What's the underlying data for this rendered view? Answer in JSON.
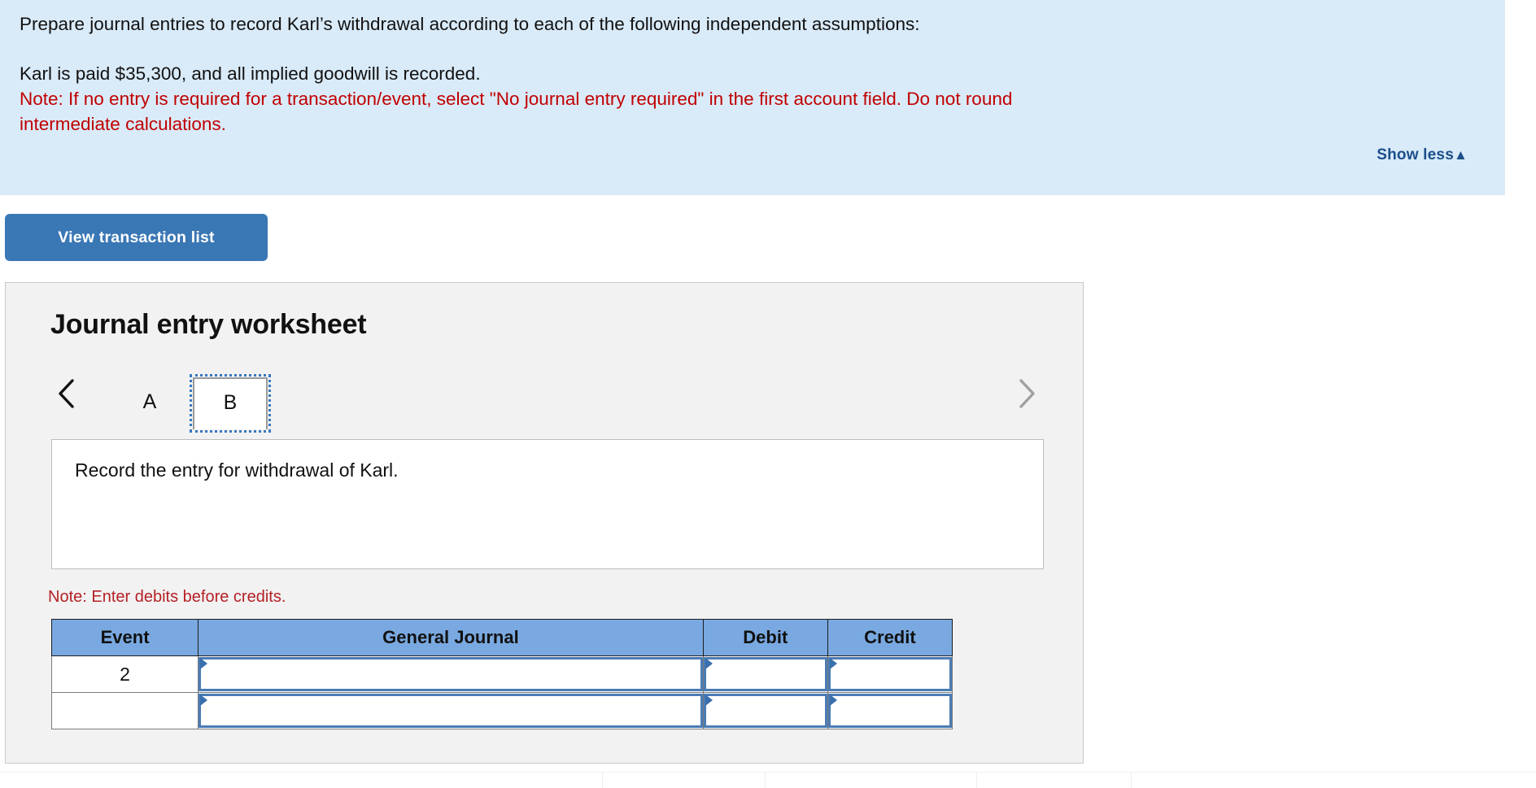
{
  "banner": {
    "instruction": "Prepare journal entries to record Karl’s withdrawal according to each of the following independent assumptions:",
    "assumption": "Karl is paid $35,300, and all implied goodwill is recorded.",
    "note_line1": "Note: If no entry is required for a transaction/event, select \"No journal entry required\" in the first account field. Do not round",
    "note_line2": "intermediate calculations.",
    "show_less_label": "Show less",
    "show_less_caret": "▲",
    "background_color": "#d9eaf8",
    "note_color": "#c00000",
    "link_color": "#1b4f8a"
  },
  "toolbar": {
    "view_transaction_list_label": "View transaction list",
    "button_color": "#3a77b5"
  },
  "worksheet": {
    "title": "Journal entry worksheet",
    "panel_background": "#f2f2f2",
    "tabs": [
      {
        "label": "A",
        "active": false
      },
      {
        "label": "B",
        "active": true
      }
    ],
    "prev_arrow_icon": "chevron-left-icon",
    "next_arrow_icon": "chevron-right-icon",
    "prompt": "Record the entry for withdrawal of Karl.",
    "debits_note": "Note: Enter debits before credits.",
    "debits_note_color": "#b52025",
    "table": {
      "header_color": "#79a9e0",
      "columns": [
        "Event",
        "General Journal",
        "Debit",
        "Credit"
      ],
      "rows": [
        {
          "event": "2",
          "general_journal": "",
          "debit": "",
          "credit": ""
        },
        {
          "event": "",
          "general_journal": "",
          "debit": "",
          "credit": ""
        }
      ]
    }
  }
}
